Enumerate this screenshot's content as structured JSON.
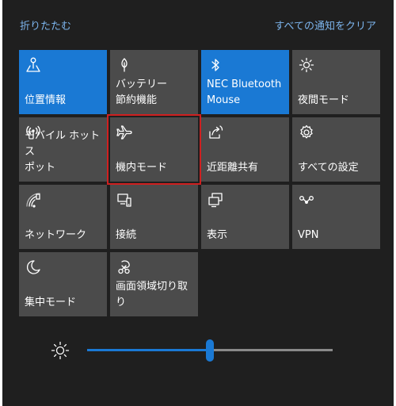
{
  "header": {
    "collapse_label": "折りたたむ",
    "clear_all_label": "すべての通知をクリア"
  },
  "colors": {
    "background": "#1f1f1f",
    "tile_off": "#4b4b4b",
    "tile_on": "#1a79d4",
    "accent": "#1a79d4",
    "link": "#7cb4ec",
    "highlight": "#cf1f1f"
  },
  "tiles": [
    {
      "label": "位置情報",
      "icon": "location-icon",
      "state": "on"
    },
    {
      "label": "バッテリー\n節約機能",
      "icon": "battery-saver-icon",
      "state": "off"
    },
    {
      "label": "NEC Bluetooth\nMouse",
      "icon": "bluetooth-icon",
      "state": "on"
    },
    {
      "label": "夜間モード",
      "icon": "night-light-icon",
      "state": "off"
    },
    {
      "label": "モバイル ホットス\nポット",
      "icon": "mobile-hotspot-icon",
      "state": "off"
    },
    {
      "label": "機内モード",
      "icon": "airplane-icon",
      "state": "off",
      "highlighted": true
    },
    {
      "label": "近距離共有",
      "icon": "nearby-share-icon",
      "state": "off"
    },
    {
      "label": "すべての設定",
      "icon": "gear-icon",
      "state": "off"
    },
    {
      "label": "ネットワーク",
      "icon": "network-icon",
      "state": "off"
    },
    {
      "label": "接続",
      "icon": "connect-icon",
      "state": "off"
    },
    {
      "label": "表示",
      "icon": "project-icon",
      "state": "off"
    },
    {
      "label": "VPN",
      "icon": "vpn-icon",
      "state": "off"
    },
    {
      "label": "集中モード",
      "icon": "focus-assist-icon",
      "state": "off"
    },
    {
      "label": "画面領域切り取\nり",
      "icon": "snip-icon",
      "state": "off"
    }
  ],
  "brightness": {
    "icon": "brightness-icon",
    "value": 0.5
  }
}
